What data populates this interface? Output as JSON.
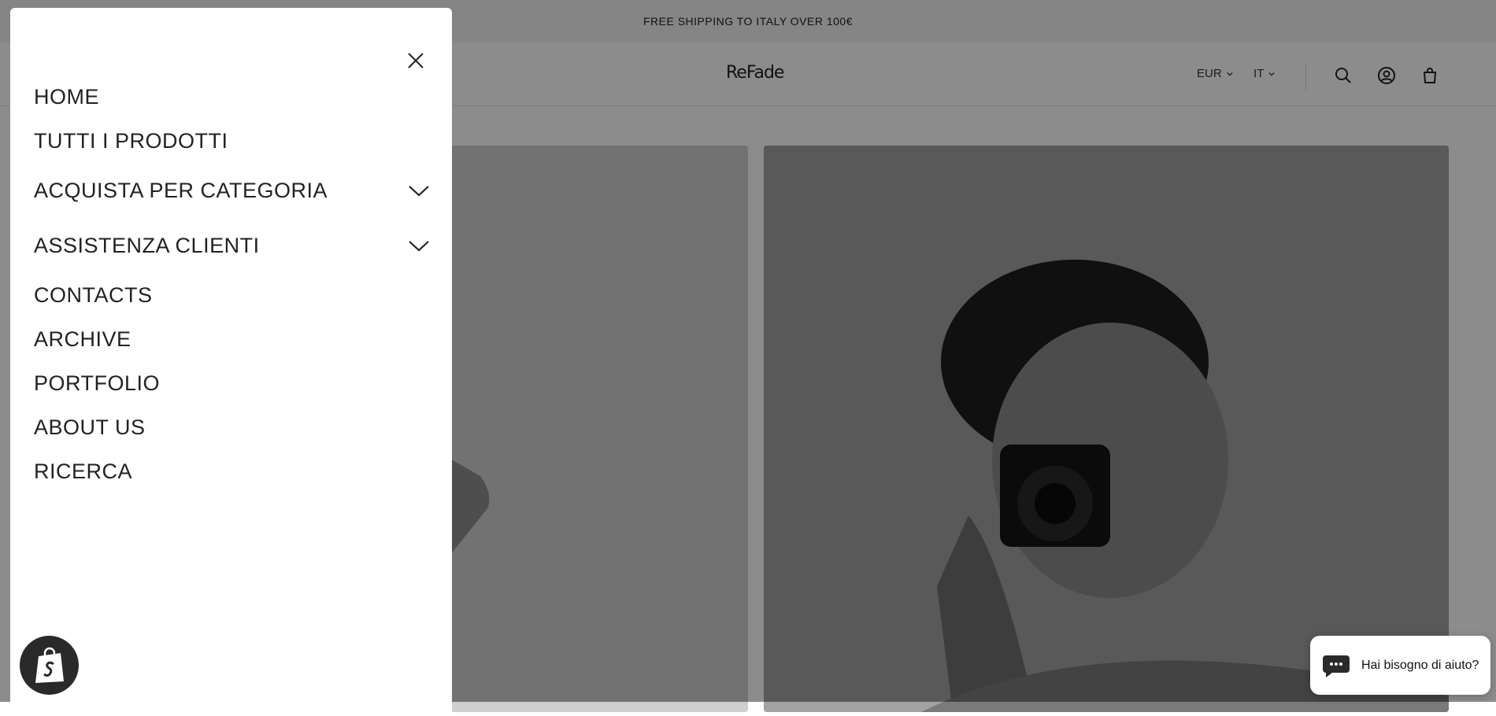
{
  "announcement": "FREE SHIPPING TO ITALY OVER 100€",
  "header": {
    "logo": "ReFade",
    "currency": "EUR",
    "language": "IT",
    "icons": [
      "search-icon",
      "account-icon",
      "cart-icon"
    ]
  },
  "menu": {
    "close_icon": "close-icon",
    "items": [
      {
        "label": "HOME"
      },
      {
        "label": "TUTTI I PRODOTTI"
      },
      {
        "label": "ACQUISTA PER CATEGORIA",
        "expandable": true
      },
      {
        "label": "ASSISTENZA CLIENTI",
        "expandable": true
      },
      {
        "label": "CONTACTS"
      },
      {
        "label": "ARCHIVE"
      },
      {
        "label": "PORTFOLIO"
      },
      {
        "label": "ABOUT US"
      },
      {
        "label": "RICERCA"
      }
    ]
  },
  "chat": {
    "label": "Hai bisogno di aiuto?"
  },
  "colors": {
    "overlay": "#000000",
    "drawer": "#ffffff",
    "badge": "#2a2a2a"
  }
}
